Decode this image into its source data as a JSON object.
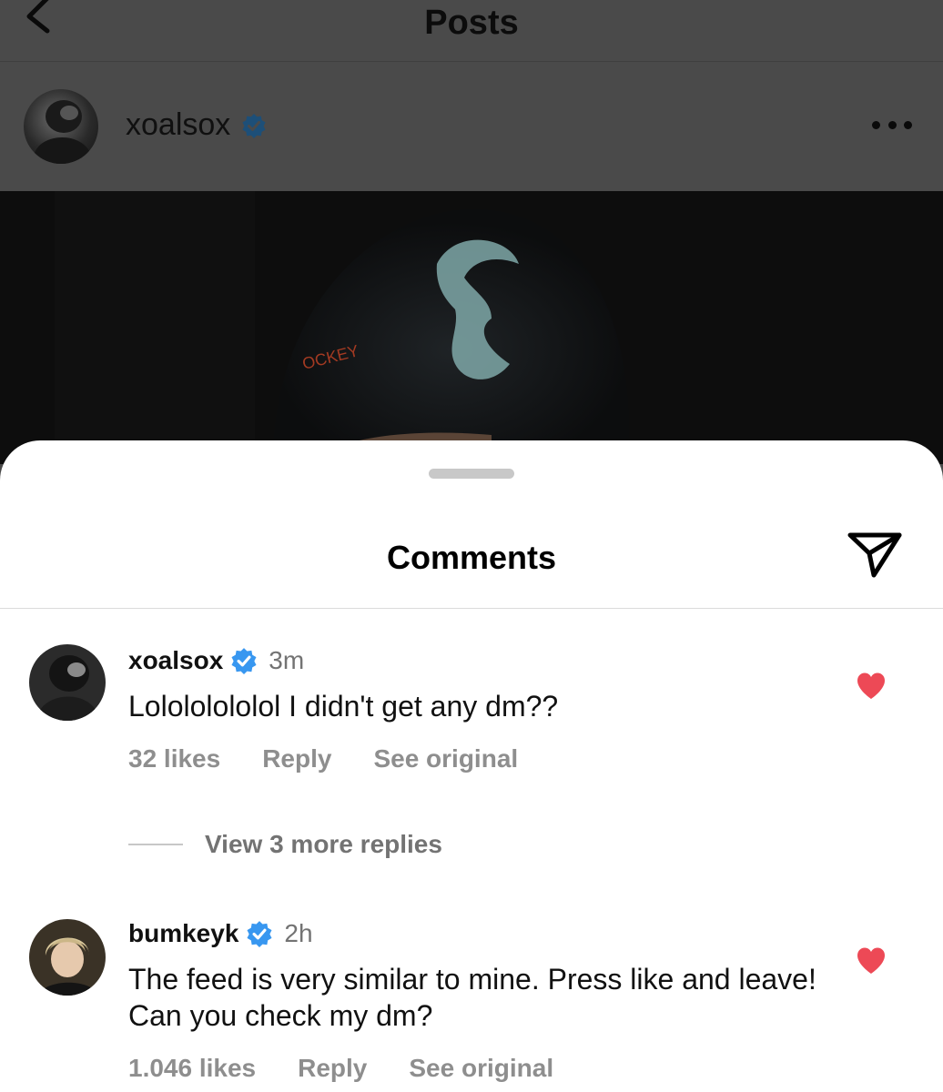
{
  "header": {
    "title": "Posts",
    "back_icon": "chevron-left-icon"
  },
  "post": {
    "username": "xoalsox",
    "verified": true,
    "more_icon": "more-horizontal-icon",
    "image_icon": "photo"
  },
  "comments_sheet": {
    "title": "Comments",
    "share_icon": "send-icon",
    "comments": [
      {
        "username": "xoalsox",
        "verified": true,
        "time": "3m",
        "text": "Lolololololol I didn't get any dm??",
        "likes": "32 likes",
        "reply_label": "Reply",
        "see_original_label": "See original",
        "liked": true
      },
      {
        "username": "bumkeyk",
        "verified": true,
        "time": "2h",
        "text": "The feed is very similar to mine. Press like and leave! Can you check my dm?",
        "likes": "1.046 likes",
        "reply_label": "Reply",
        "see_original_label": "See original",
        "liked": true
      }
    ],
    "view_replies_label": "View 3 more replies"
  },
  "colors": {
    "heart": "#ed4956",
    "verified": "#3897f0",
    "muted_text": "#8e8e8e",
    "overlay_dim": "#4a4a4a"
  }
}
